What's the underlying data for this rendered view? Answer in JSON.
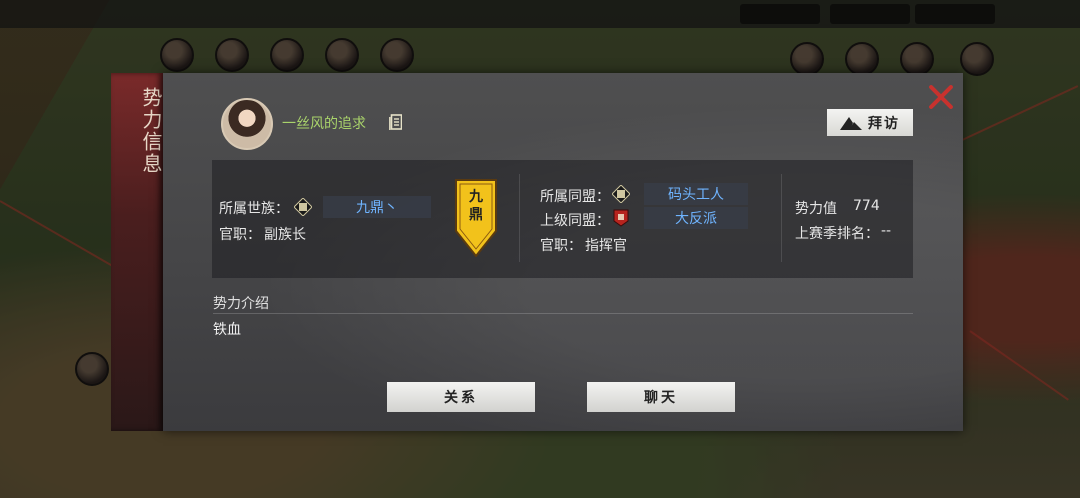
{
  "side_tab": {
    "title": "势力信息"
  },
  "player": {
    "name": "一丝风的追求"
  },
  "visit_button": {
    "label": "拜访"
  },
  "clan": {
    "label": "所属世族：",
    "value": "九鼎丶",
    "position_label": "官职：",
    "position": "副族长",
    "banner_text": "九鼎"
  },
  "alliance": {
    "label": "所属同盟：",
    "value": "码头工人",
    "parent_label": "上级同盟：",
    "parent_value": "大反派",
    "position_label": "官职：",
    "position": "指挥官"
  },
  "stats": {
    "power_label": "势力值",
    "power_value": "774",
    "rank_label": "上赛季排名：",
    "rank_value": "--"
  },
  "intro": {
    "title": "势力介绍",
    "text": "铁血"
  },
  "buttons": {
    "relation": "关系",
    "chat": "聊天"
  },
  "colors": {
    "name_green": "#a9d36b",
    "link_blue": "#6fb4ff",
    "close_red": "#c8322e",
    "tab_red": "#7a2a2a",
    "banner_yellow": "#f2c21b"
  },
  "icons": [
    "copy-icon",
    "visit-icon",
    "close-icon",
    "clan-emblem-icon",
    "alliance-emblem-icon",
    "parent-alliance-emblem-icon"
  ]
}
